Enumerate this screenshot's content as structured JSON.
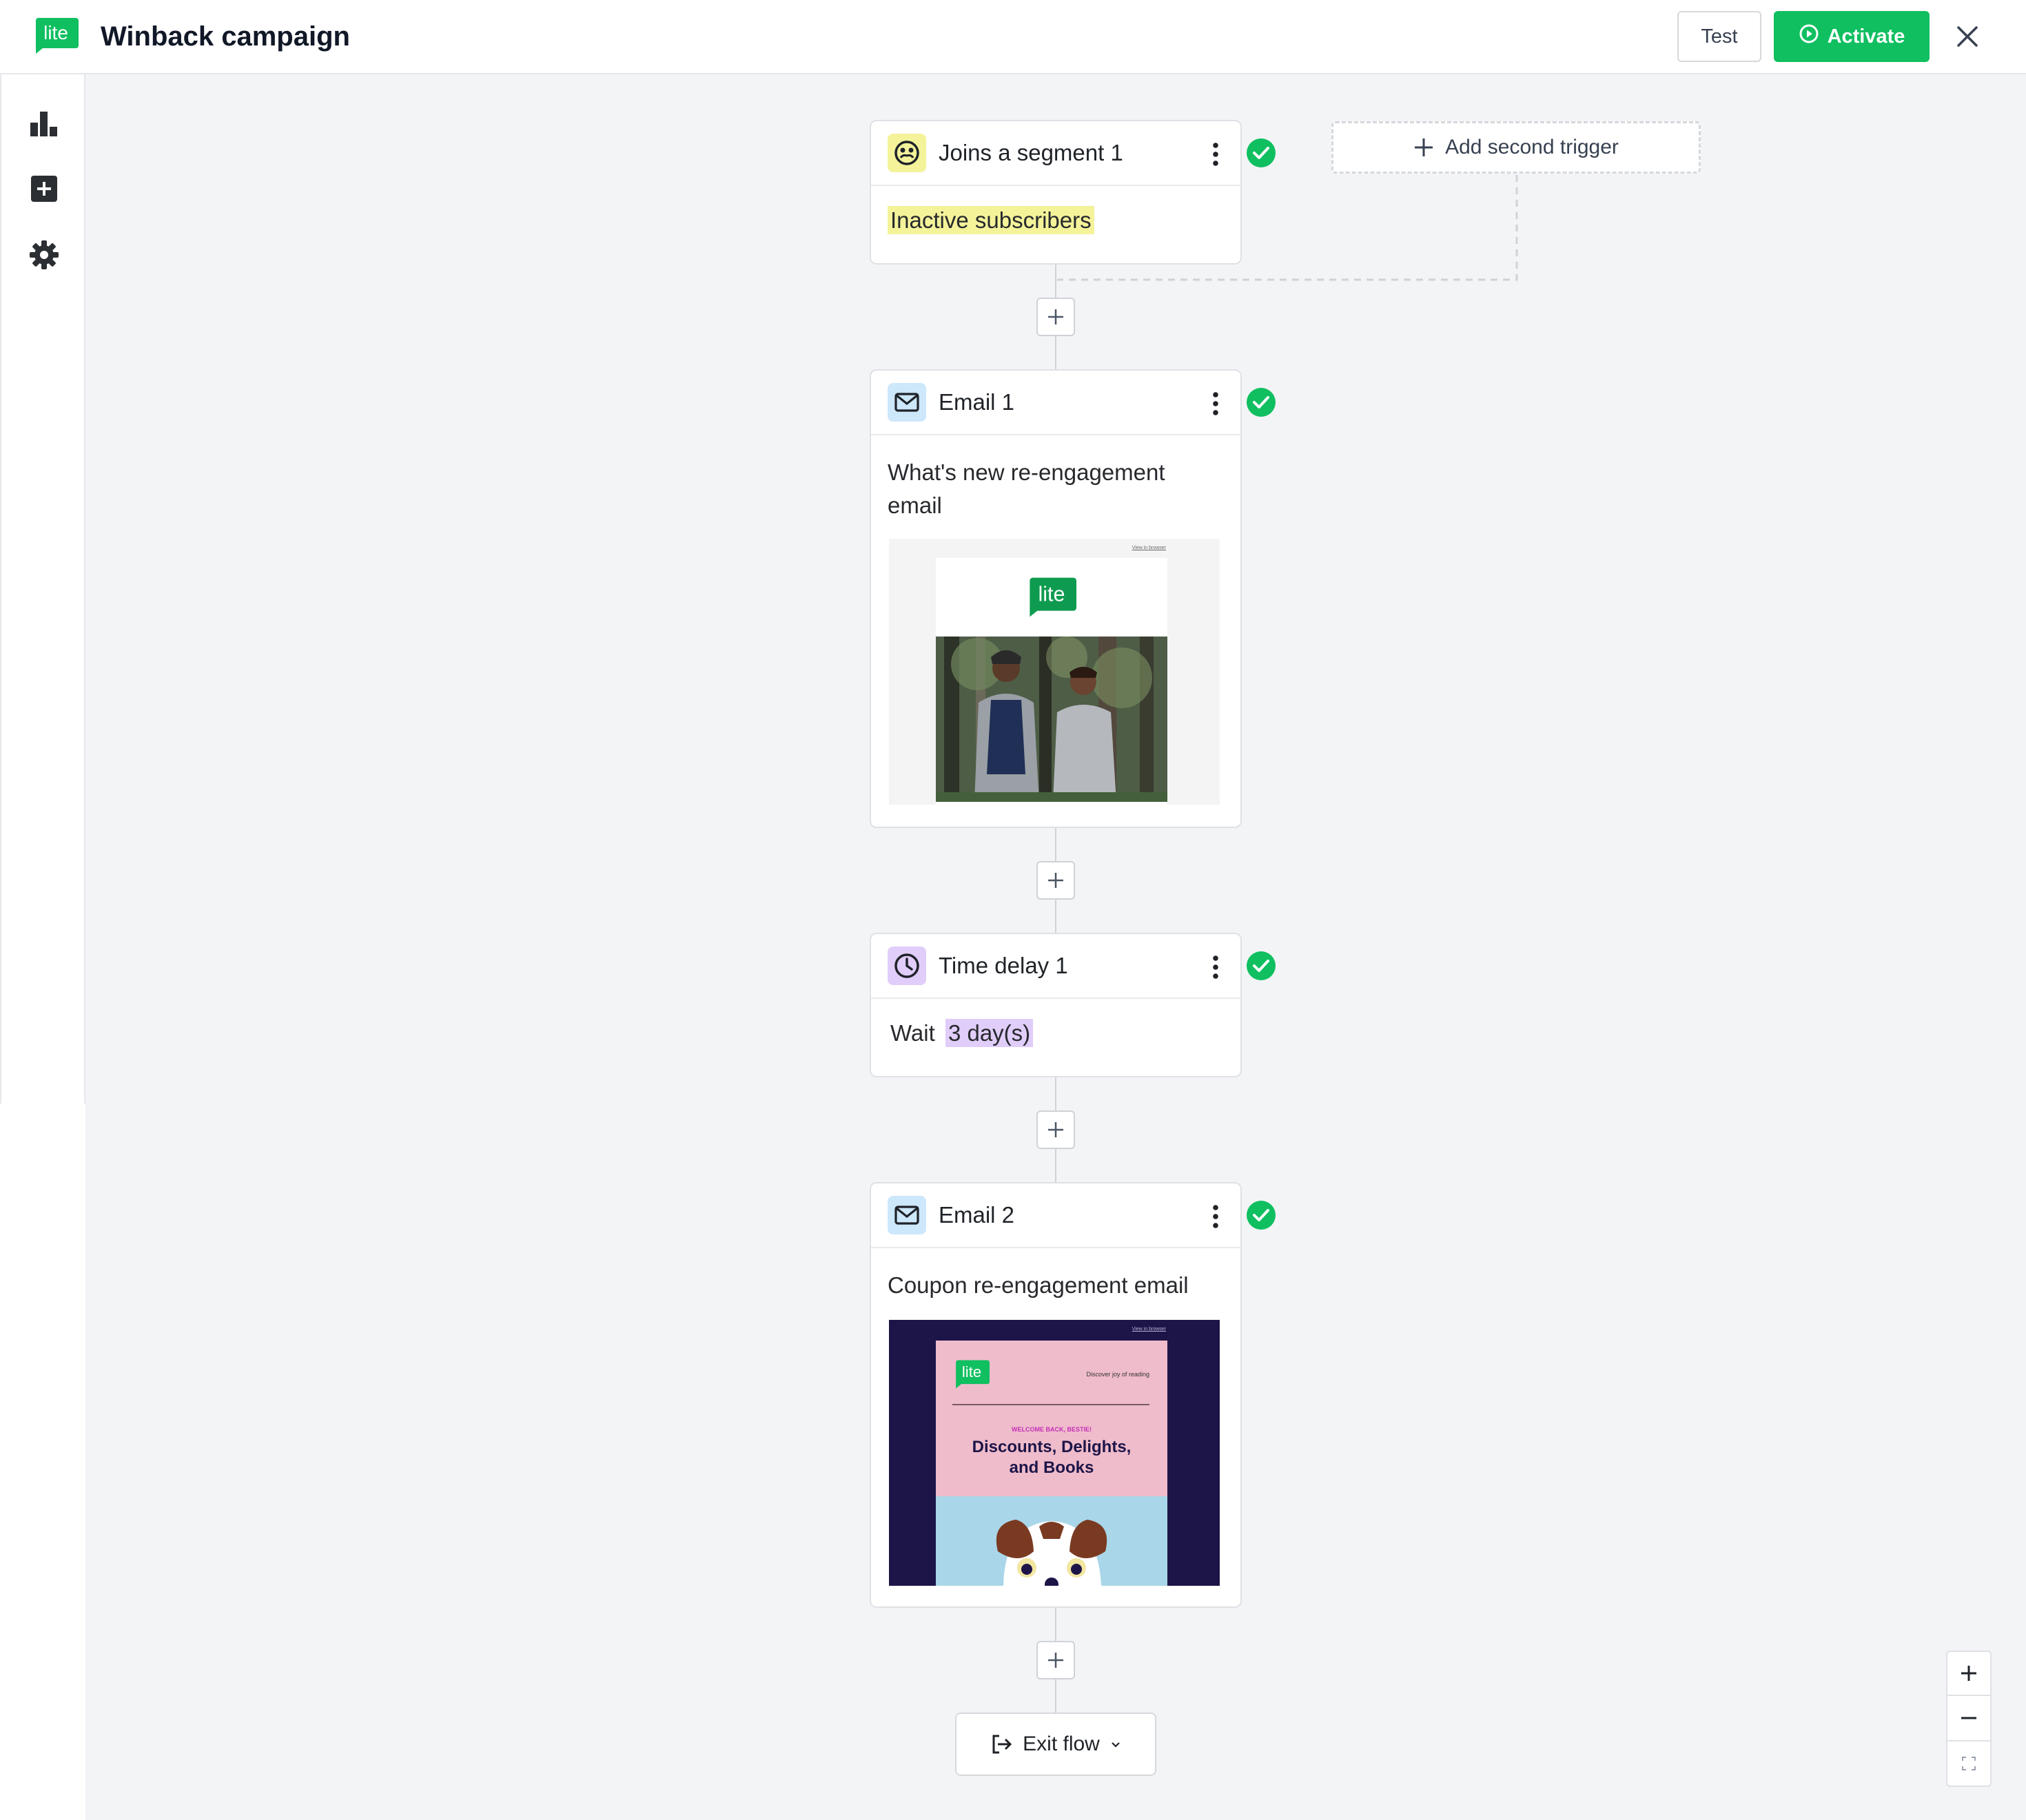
{
  "app": {
    "title": "Winback campaign",
    "logo_text": "lite",
    "brand_color": "#0fbf60"
  },
  "toolbar": {
    "test_label": "Test",
    "activate_label": "Activate"
  },
  "sidebar": {
    "items": [
      {
        "icon": "bar-chart-icon"
      },
      {
        "icon": "add-square-icon"
      },
      {
        "icon": "gear-icon"
      }
    ]
  },
  "flow": {
    "trigger": {
      "title": "Joins a segment 1",
      "segment": "Inactive subscribers",
      "status": "complete"
    },
    "add_trigger_label": "Add second trigger",
    "email1": {
      "title": "Email 1",
      "subject": "What's new re-engagement email",
      "preview": {
        "logo_text": "lite",
        "top_link": "View in browser"
      },
      "status": "complete"
    },
    "delay": {
      "title": "Time delay 1",
      "prefix": "Wait",
      "duration": "3 day(s)",
      "status": "complete"
    },
    "email2": {
      "title": "Email 2",
      "subject": "Coupon re-engagement email",
      "preview": {
        "logo_text": "lite",
        "top_link": "View in browser",
        "tagline": "Discover joy of reading",
        "eyebrow": "WELCOME BACK, BESTIE!",
        "headline": "Discounts, Delights, and Books"
      },
      "status": "complete"
    },
    "exit_label": "Exit flow"
  }
}
